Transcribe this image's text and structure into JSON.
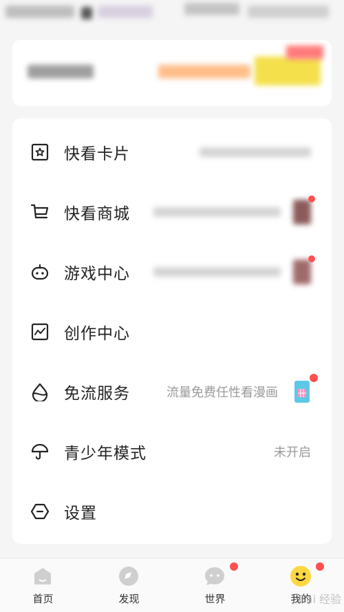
{
  "menu": {
    "items": [
      {
        "label": "快看卡片",
        "sub": ""
      },
      {
        "label": "快看商城",
        "sub": ""
      },
      {
        "label": "游戏中心",
        "sub": ""
      },
      {
        "label": "创作中心",
        "sub": ""
      },
      {
        "label": "免流服务",
        "sub": "流量免费任性看漫画"
      },
      {
        "label": "青少年模式",
        "sub": "未开启"
      },
      {
        "label": "设置",
        "sub": ""
      }
    ]
  },
  "tabbar": {
    "tabs": [
      {
        "label": "首页"
      },
      {
        "label": "发现"
      },
      {
        "label": "世界"
      },
      {
        "label": "我的"
      }
    ]
  },
  "watermark": "Bai 经验",
  "colors": {
    "accent": "#ffd740",
    "badge": "#ff4f4f",
    "vip_orange": "#ffb070"
  }
}
